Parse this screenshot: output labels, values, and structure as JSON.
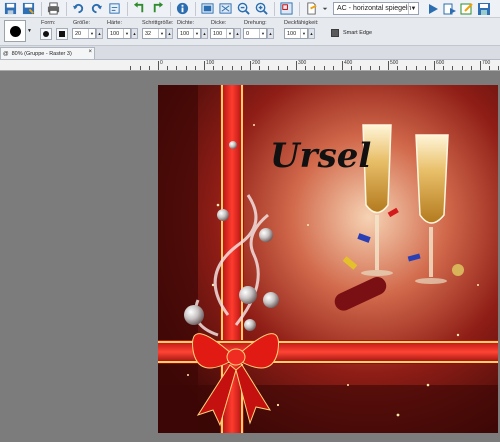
{
  "toolbar": {
    "preset": "AC - horizontal spiegeln"
  },
  "options": {
    "labels": {
      "form": "Form:",
      "size": "Größe:",
      "hardness": "Härte:",
      "step": "Schrittgröße:",
      "density": "Dichte:",
      "thickness": "Dicke:",
      "rotation": "Drehung:",
      "opacity": "Deckfähigkeit:"
    },
    "values": {
      "size": "20",
      "hardness": "100",
      "step": "32",
      "density": "100",
      "thickness": "100",
      "rotation": "0",
      "opacity": "100"
    },
    "smart_edge_label": "Smart Edge"
  },
  "tab": {
    "icon": "@",
    "title": "80% (Gruppe - Raster 3)",
    "close": "×"
  },
  "ruler": {
    "labels": [
      "0",
      "100",
      "200",
      "300",
      "400",
      "500",
      "600",
      "700"
    ]
  },
  "canvas": {
    "signature": "Ursel"
  }
}
